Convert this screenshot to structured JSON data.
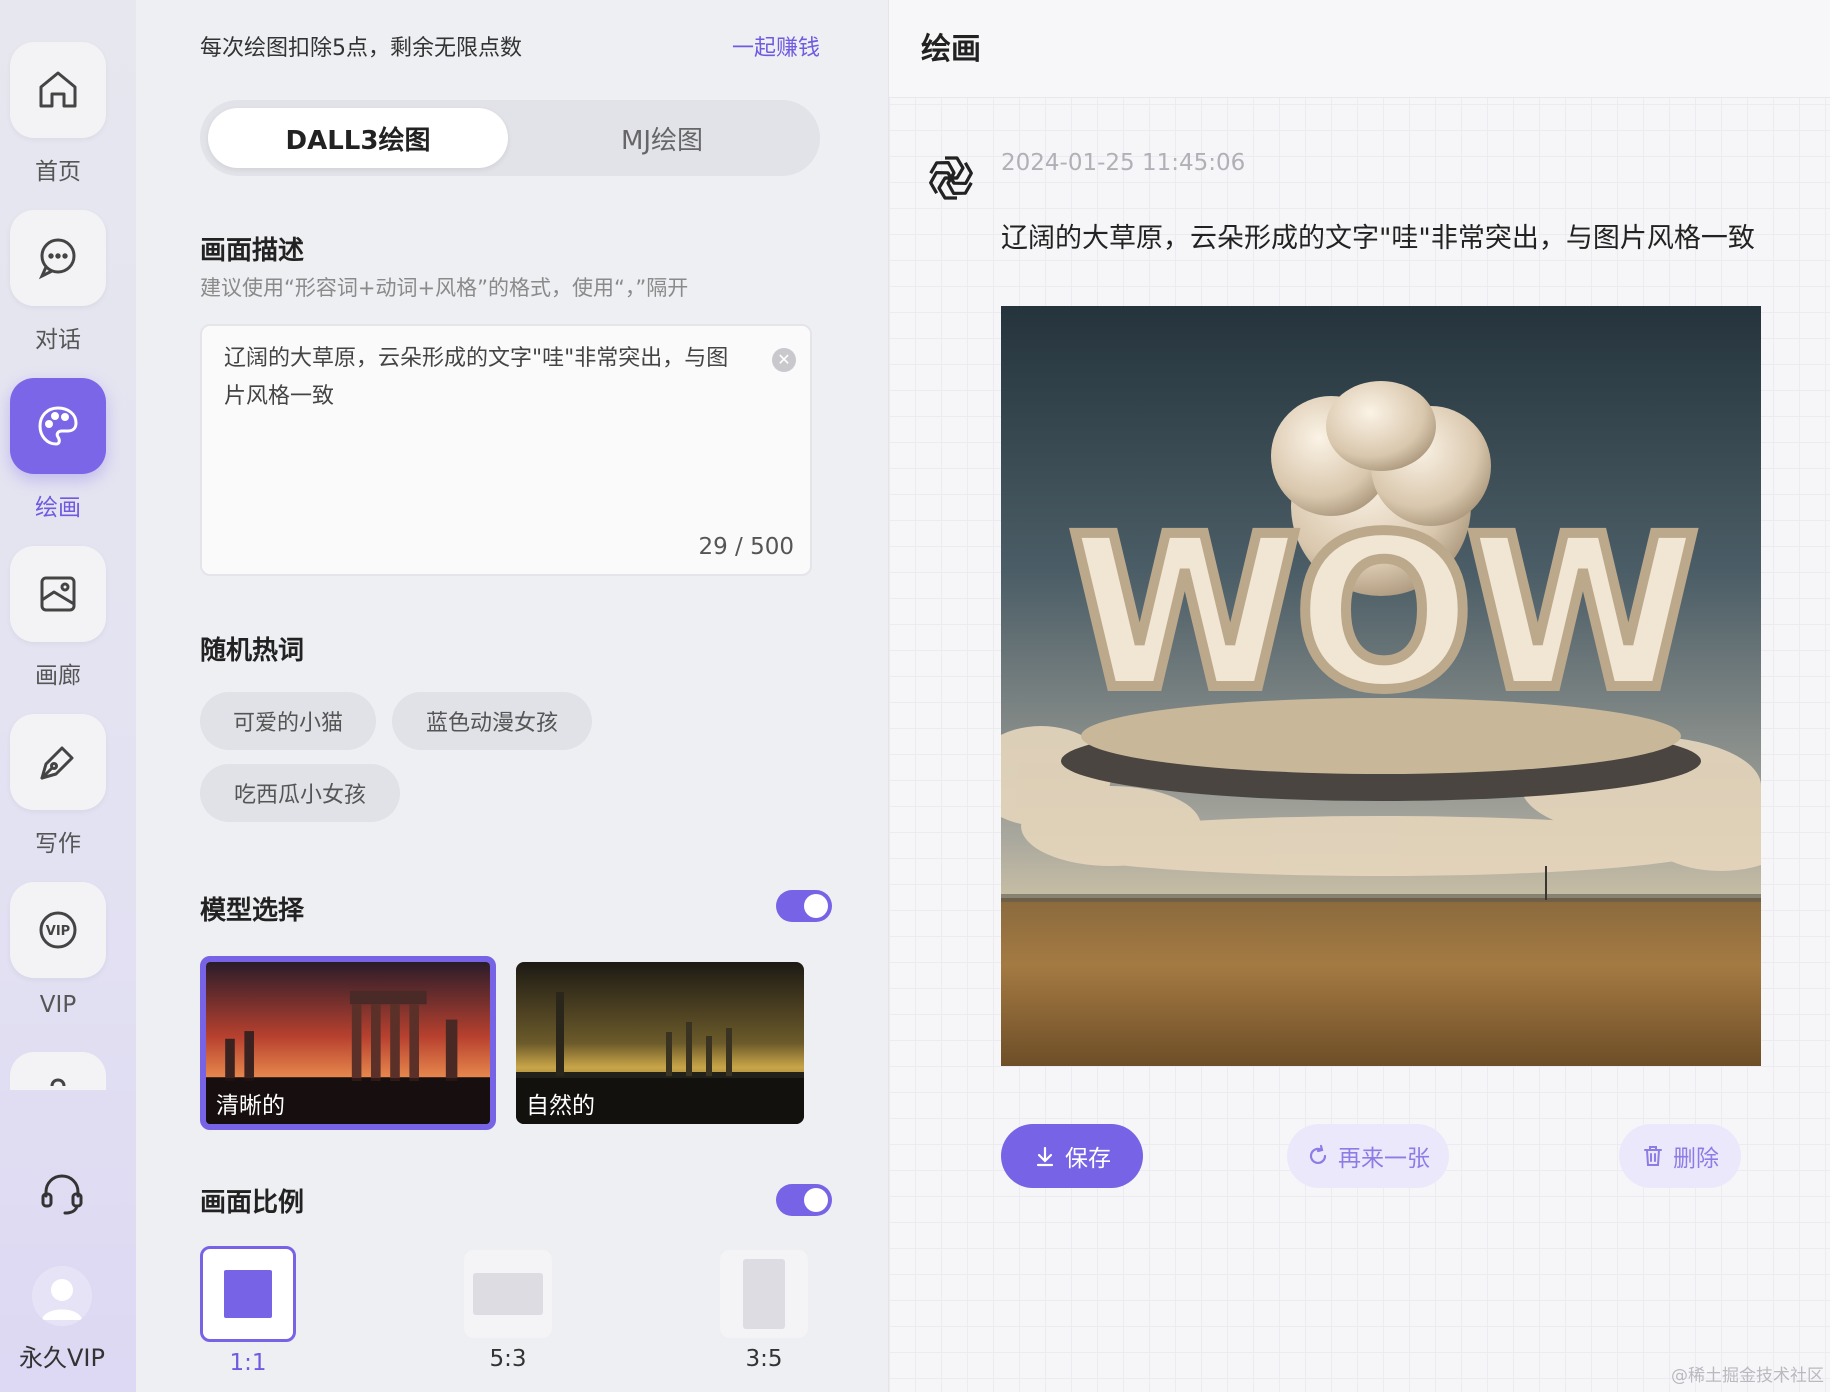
{
  "nav": {
    "items": [
      {
        "label": "首页",
        "icon": "home-icon"
      },
      {
        "label": "对话",
        "icon": "chat-icon"
      },
      {
        "label": "绘画",
        "icon": "palette-icon",
        "active": true
      },
      {
        "label": "画廊",
        "icon": "gallery-icon"
      },
      {
        "label": "写作",
        "icon": "pen-icon"
      },
      {
        "label": "VIP",
        "icon": "vip-icon"
      }
    ],
    "user_label": "永久VIP"
  },
  "panel": {
    "points_text": "每次绘图扣除5点，剩余无限点数",
    "earn_link": "一起赚钱",
    "tabs": [
      {
        "label": "DALL3绘图",
        "selected": true
      },
      {
        "label": "MJ绘图",
        "selected": false
      }
    ],
    "description": {
      "title": "画面描述",
      "hint": "建议使用“形容词+动词+风格”的格式，使用“，”隔开",
      "value": "辽阔的大草原，云朵形成的文字\"哇\"非常突出，与图片风格一致",
      "counter": "29 / 500"
    },
    "hot_words": {
      "title": "随机热词",
      "chips": [
        "可爱的小猫",
        "蓝色动漫女孩",
        "吃西瓜小女孩"
      ]
    },
    "model": {
      "title": "模型选择",
      "toggle_on": true,
      "options": [
        {
          "label": "清晰的",
          "selected": true
        },
        {
          "label": "自然的",
          "selected": false
        }
      ]
    },
    "ratio": {
      "title": "画面比例",
      "toggle_on": true,
      "options": [
        {
          "label": "1:1",
          "selected": true
        },
        {
          "label": "5:3",
          "selected": false
        },
        {
          "label": "3:5",
          "selected": false
        }
      ]
    }
  },
  "main": {
    "title": "绘画",
    "timestamp": "2024-01-25 11:45:06",
    "prompt": "辽阔的大草原，云朵形成的文字\"哇\"非常突出，与图片风格一致",
    "image_text": "WOW",
    "actions": {
      "save": "保存",
      "regenerate": "再来一张",
      "delete": "删除"
    }
  },
  "watermark": "@稀土掘金技术社区",
  "colors": {
    "accent": "#7763e6",
    "accent_text": "#6f5ae0",
    "ghost_button": "#ece8fb"
  }
}
